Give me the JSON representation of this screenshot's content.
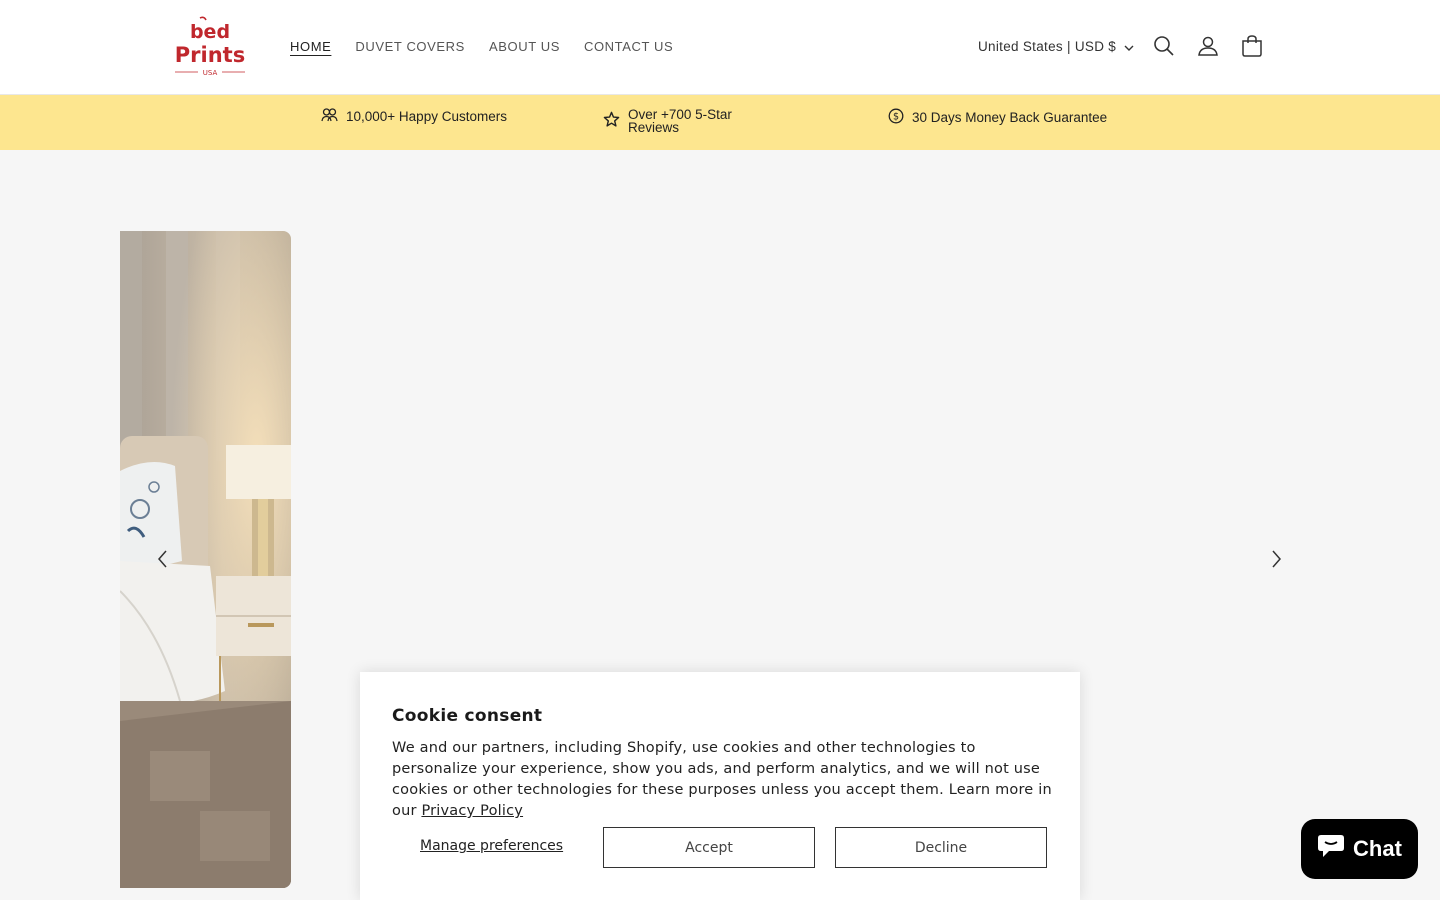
{
  "header": {
    "logo": {
      "line1": "bed",
      "line2": "Prints",
      "line3": "USA",
      "color": "#c0272d"
    },
    "nav": [
      {
        "label": "HOME",
        "active": true
      },
      {
        "label": "DUVET COVERS",
        "active": false
      },
      {
        "label": "ABOUT US",
        "active": false
      },
      {
        "label": "CONTACT US",
        "active": false
      }
    ],
    "country_selector": "United States | USD $",
    "icons": [
      "search-icon",
      "account-icon",
      "cart-icon"
    ]
  },
  "announcement": {
    "background": "#fde68f",
    "items": [
      {
        "icon": "customers-icon",
        "text": "10,000+ Happy Customers"
      },
      {
        "icon": "star-icon",
        "text_line1": "Over +700 5-Star",
        "text_line2": "Reviews"
      },
      {
        "icon": "dollar-icon",
        "text": "30 Days Money Back Guarantee"
      }
    ]
  },
  "slider": {
    "prev_icon": "chevron-left-icon",
    "next_icon": "chevron-right-icon"
  },
  "cookie": {
    "title": "Cookie consent",
    "body": "We and our partners, including Shopify, use cookies and other technologies to personalize your experience, show you ads, and perform analytics, and we will not use cookies or other technologies for these purposes unless you accept them. Learn more in our ",
    "link": "Privacy Policy",
    "manage": "Manage preferences",
    "accept": "Accept",
    "decline": "Decline"
  },
  "chat": {
    "label": "Chat",
    "icon": "chat-bubble-icon",
    "background": "#000000"
  }
}
